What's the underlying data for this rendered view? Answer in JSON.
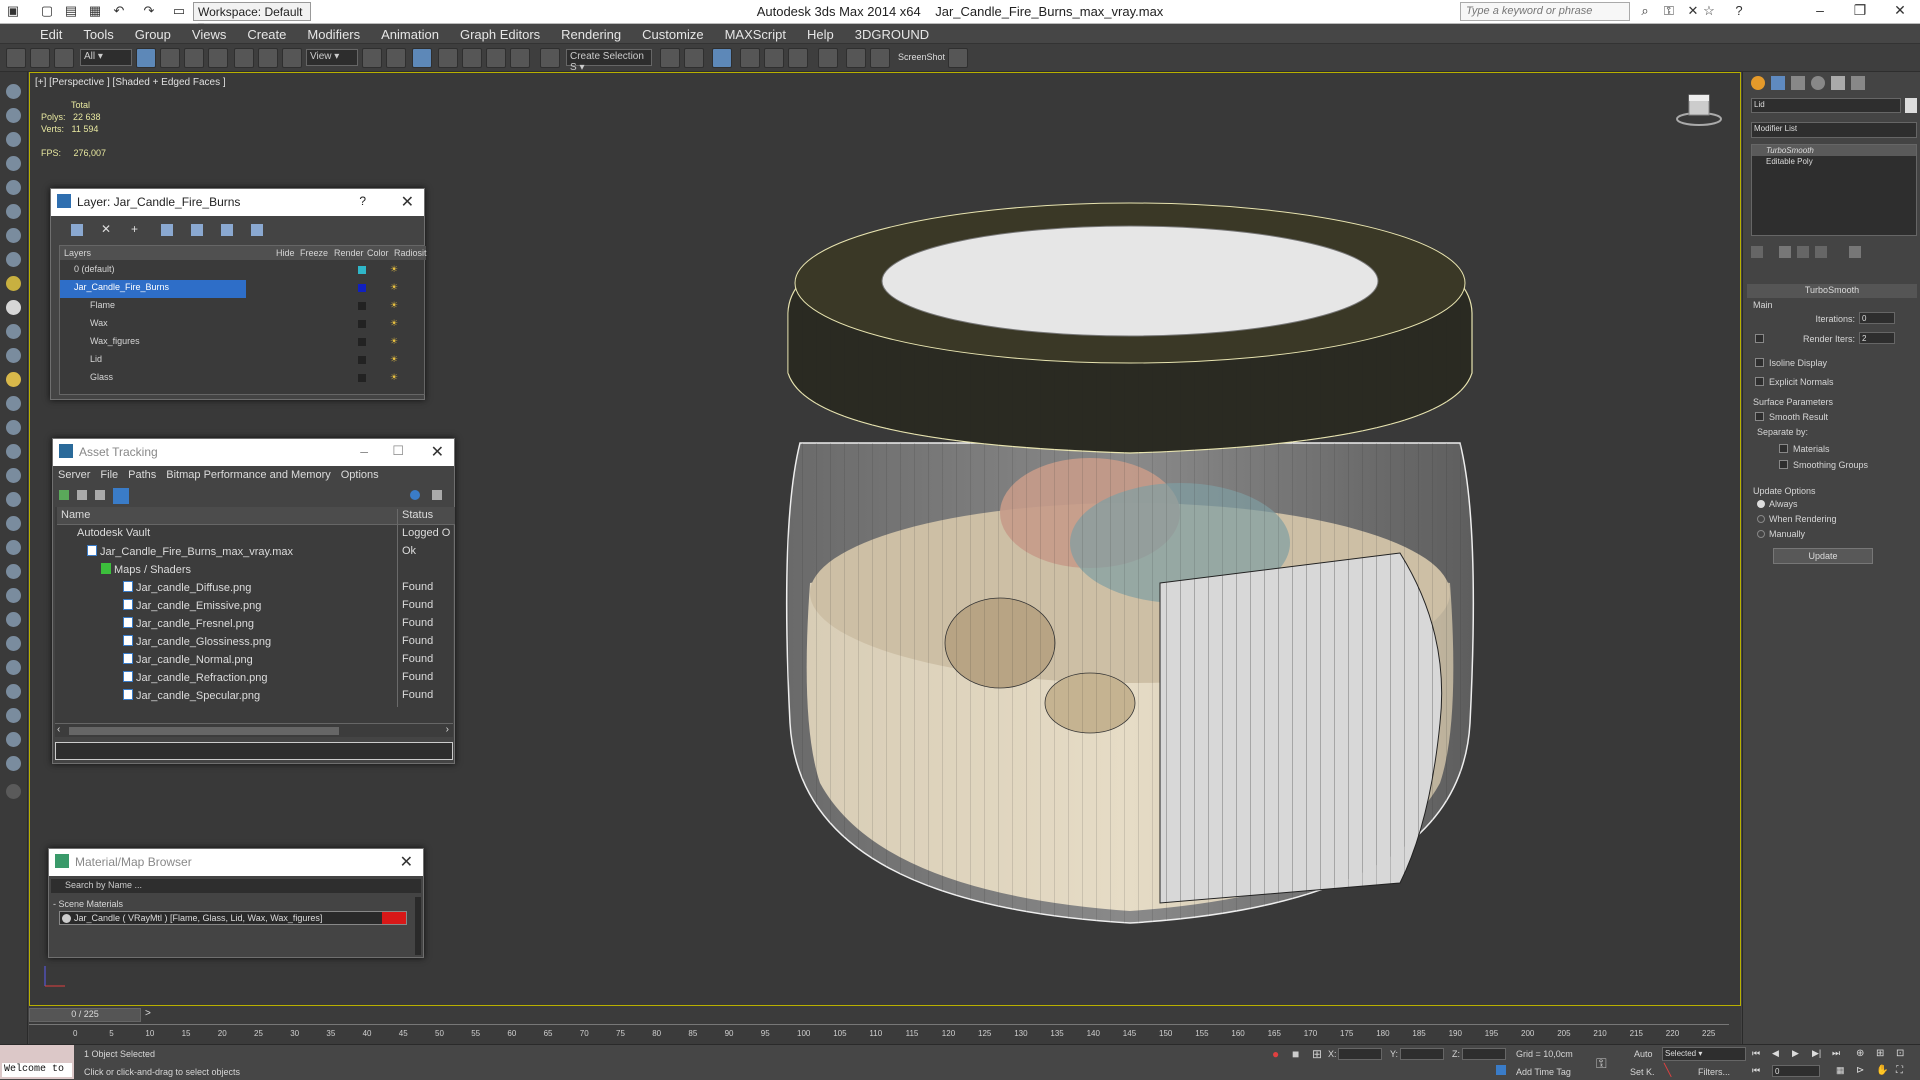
{
  "title_bar": {
    "workspace": "Workspace: Default",
    "app_title": "Autodesk 3ds Max  2014 x64",
    "file_title": "Jar_Candle_Fire_Burns_max_vray.max",
    "search_placeholder": "Type a keyword or phrase"
  },
  "menu": [
    "Edit",
    "Tools",
    "Group",
    "Views",
    "Create",
    "Modifiers",
    "Animation",
    "Graph Editors",
    "Rendering",
    "Customize",
    "MAXScript",
    "Help",
    "3DGROUND"
  ],
  "toolbar": {
    "filter": "All",
    "refcoord": "View",
    "selection_set": "Create Selection S",
    "screenshot": "ScreenShot"
  },
  "viewport": {
    "label": "[+] [Perspective ] [Shaded + Edged Faces ]",
    "stats_total": "Total",
    "polys_label": "Polys:",
    "polys_value": "22 638",
    "verts_label": "Verts:",
    "verts_value": "11 594",
    "fps_label": "FPS:",
    "fps_value": "276,007"
  },
  "layer_window": {
    "title": "Layer: Jar_Candle_Fire_Burns",
    "help": "?",
    "columns": [
      "Layers",
      "Hide",
      "Freeze",
      "Render",
      "Color",
      "Radiosit"
    ],
    "rows": [
      {
        "name": "0 (default)",
        "color": "#2fb6c8"
      },
      {
        "name": "Jar_Candle_Fire_Burns",
        "color": "#1020c0"
      },
      {
        "name": "Flame",
        "color": "#222222"
      },
      {
        "name": "Wax",
        "color": "#222222"
      },
      {
        "name": "Wax_figures",
        "color": "#222222"
      },
      {
        "name": "Lid",
        "color": "#222222"
      },
      {
        "name": "Glass",
        "color": "#222222"
      }
    ]
  },
  "asset_tracking": {
    "title": "Asset Tracking",
    "menu": [
      "Server",
      "File",
      "Paths",
      "Bitmap Performance and Memory",
      "Options"
    ],
    "col_name": "Name",
    "col_status": "Status",
    "rows": [
      {
        "name": "Autodesk Vault",
        "status": "Logged O"
      },
      {
        "name": "Jar_Candle_Fire_Burns_max_vray.max",
        "status": "Ok"
      },
      {
        "name": "Maps / Shaders",
        "status": ""
      },
      {
        "name": "Jar_candle_Diffuse.png",
        "status": "Found"
      },
      {
        "name": "Jar_candle_Emissive.png",
        "status": "Found"
      },
      {
        "name": "Jar_candle_Fresnel.png",
        "status": "Found"
      },
      {
        "name": "Jar_candle_Glossiness.png",
        "status": "Found"
      },
      {
        "name": "Jar_candle_Normal.png",
        "status": "Found"
      },
      {
        "name": "Jar_candle_Refraction.png",
        "status": "Found"
      },
      {
        "name": "Jar_candle_Specular.png",
        "status": "Found"
      }
    ]
  },
  "material_browser": {
    "title": "Material/Map Browser",
    "search": "Search by Name ...",
    "group": "- Scene Materials",
    "item": "Jar_Candle  ( VRayMtl )  [Flame, Glass, Lid, Wax, Wax_figures]"
  },
  "command_panel": {
    "object_name": "Lid",
    "modifier_list": "Modifier List",
    "stack": [
      "TurboSmooth",
      "Editable Poly"
    ],
    "rollout_title": "TurboSmooth",
    "main": "Main",
    "iterations_label": "Iterations:",
    "iterations_value": "0",
    "render_iters_label": "Render Iters:",
    "render_iters_value": "2",
    "isoline": "Isoline Display",
    "explicit": "Explicit Normals",
    "surface_params": "Surface Parameters",
    "smooth_result": "Smooth Result",
    "separate_by": "Separate by:",
    "materials": "Materials",
    "smoothing_groups": "Smoothing Groups",
    "update_options": "Update Options",
    "always": "Always",
    "when_rendering": "When Rendering",
    "manually": "Manually",
    "update_btn": "Update"
  },
  "timeline": {
    "frame": "0 / 225",
    "ticks": [
      "0",
      "5",
      "10",
      "15",
      "20",
      "25",
      "30",
      "35",
      "40",
      "45",
      "50",
      "55",
      "60",
      "65",
      "70",
      "75",
      "80",
      "85",
      "90",
      "95",
      "100",
      "105",
      "110",
      "115",
      "120",
      "125",
      "130",
      "135",
      "140",
      "145",
      "150",
      "155",
      "160",
      "165",
      "170",
      "175",
      "180",
      "185",
      "190",
      "195",
      "200",
      "205",
      "210",
      "215",
      "220",
      "225"
    ]
  },
  "status": {
    "welcome": "Welcome to",
    "selected": "1 Object Selected",
    "prompt": "Click or click-and-drag to select objects",
    "x_label": "X:",
    "y_label": "Y:",
    "z_label": "Z:",
    "grid": "Grid = 10,0cm",
    "auto": "Auto",
    "set_key": "Set K.",
    "selected_dropdown": "Selected",
    "filters": "Filters...",
    "add_time_tag": "Add Time Tag",
    "frame_value": "0"
  }
}
